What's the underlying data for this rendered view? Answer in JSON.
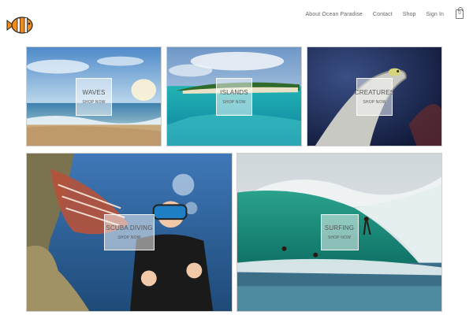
{
  "brand": {
    "logo_icon": "clownfish-logo-icon",
    "colors": {
      "orange": "#f28a1e",
      "dark": "#2b2b2b"
    }
  },
  "nav": {
    "about": "About Ocean Paradise",
    "contact": "Contact",
    "shop": "Shop",
    "sign_in": "Sign In",
    "cart_count": "0",
    "cart_icon": "shopping-bag-icon"
  },
  "tiles": {
    "waves": {
      "title": "WAVES",
      "cta": "SHOP NOW"
    },
    "islands": {
      "title": "ISLANDS",
      "cta": "SHOP NOW"
    },
    "creatures": {
      "title": "CREATURES",
      "cta": "SHOP NOW"
    },
    "scuba": {
      "title": "SCUBA DIVING",
      "cta": "SHOP NOW"
    },
    "surfing": {
      "title": "SURFING",
      "cta": "SHOP NOW"
    }
  }
}
